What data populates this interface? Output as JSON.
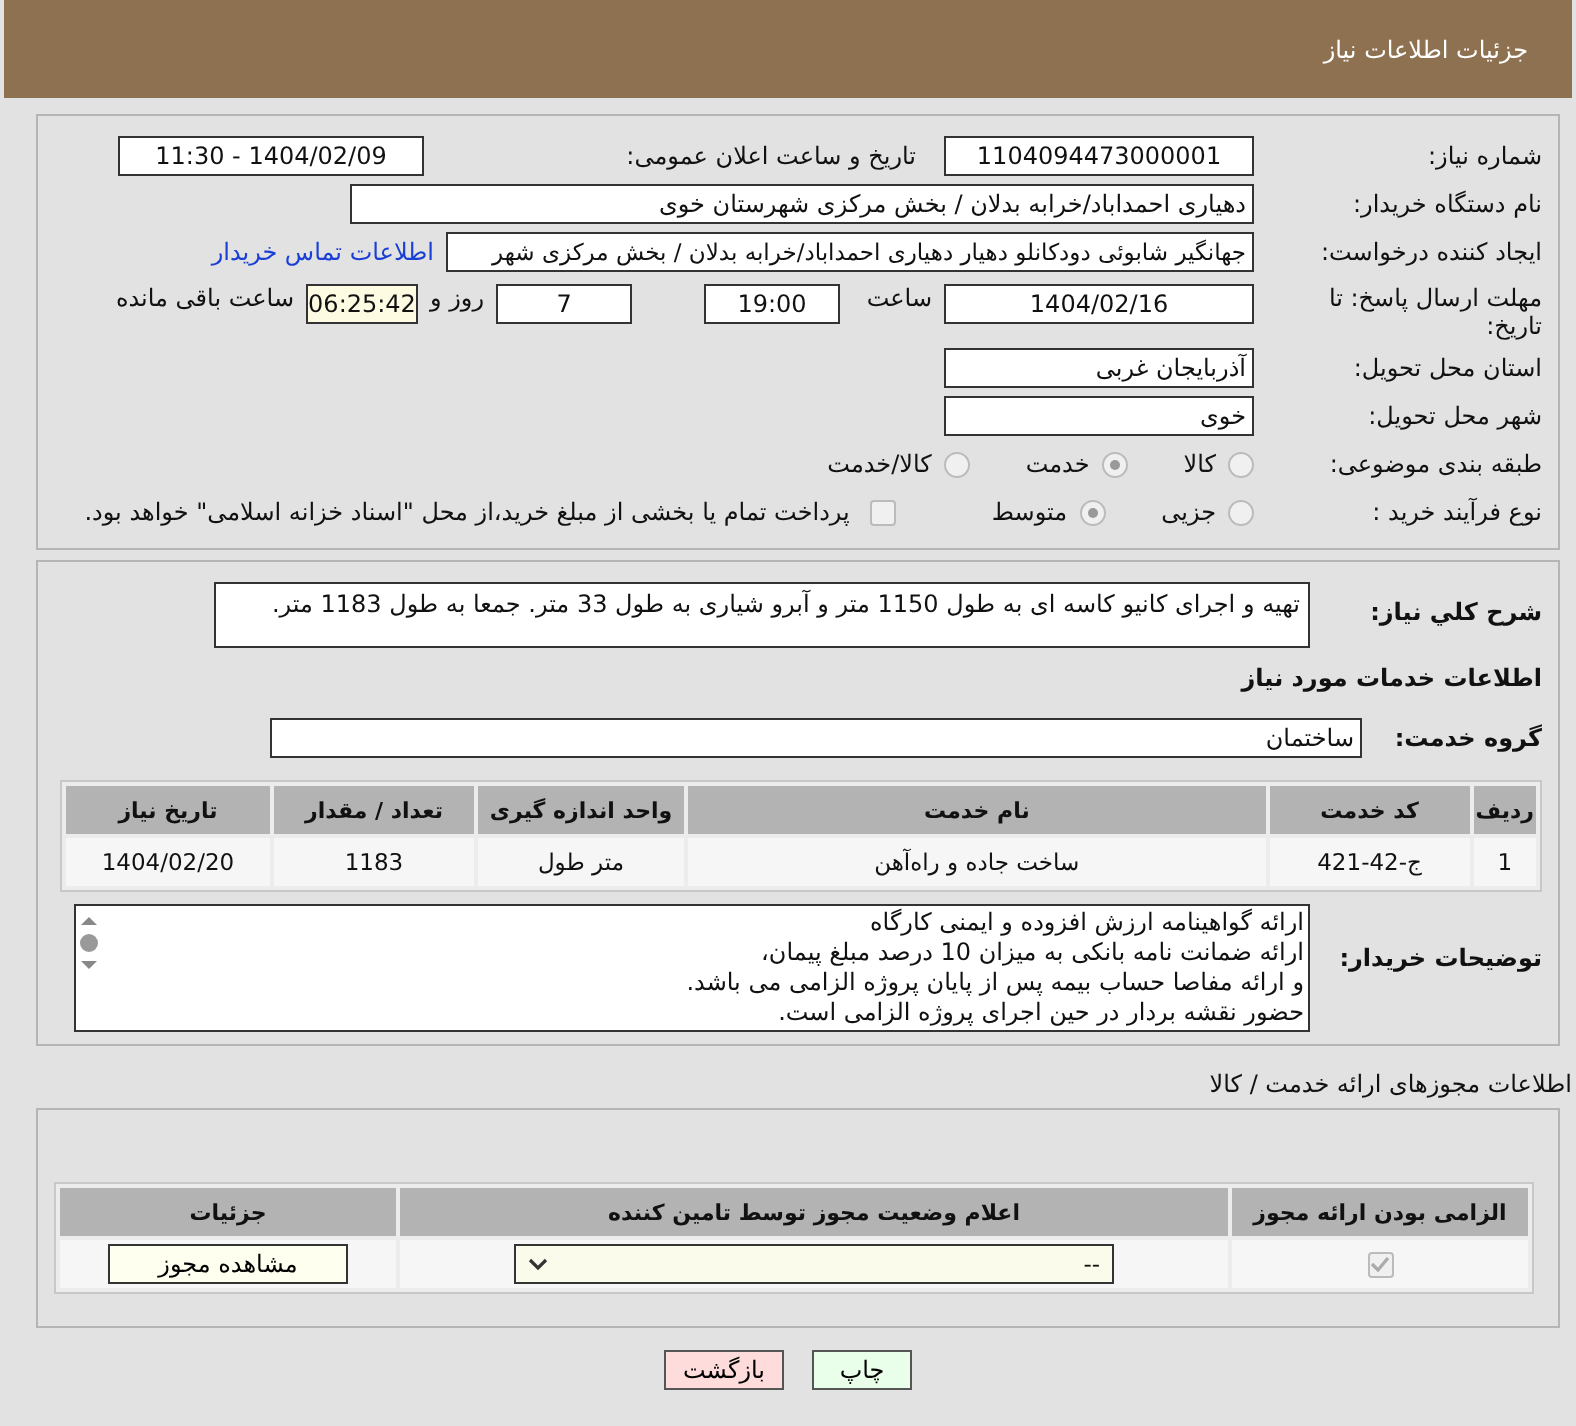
{
  "header": {
    "title": "جزئیات اطلاعات نیاز"
  },
  "need_info": {
    "need_number": {
      "label": "شماره نیاز:",
      "value": "1104094473000001"
    },
    "announce": {
      "label": "تاریخ و ساعت اعلان عمومی:",
      "value": "1404/02/09 - 11:30"
    },
    "buyer_org": {
      "label": "نام دستگاه خریدار:",
      "value": "دهیاری احمداباد/خرابه بدلان / بخش مرکزی شهرستان خوی"
    },
    "requester": {
      "label": "ایجاد کننده درخواست:",
      "value": "جهانگیر شابوئی دودکانلو دهیار دهیاری احمداباد/خرابه بدلان / بخش مرکزی شهر",
      "link": "اطلاعات تماس خریدار"
    },
    "deadline": {
      "label": "مهلت ارسال پاسخ: تا تاریخ:",
      "date": "1404/02/16",
      "time_label": "ساعت",
      "time": "19:00",
      "days": "7",
      "days_label": "روز و",
      "remaining": "06:25:42",
      "remaining_label": "ساعت باقی مانده"
    },
    "province": {
      "label": "استان محل تحویل:",
      "value": "آذربایجان غربی"
    },
    "city": {
      "label": "شهر محل تحویل:",
      "value": "خوی"
    },
    "category": {
      "label": "طبقه بندی موضوعی:",
      "options": [
        {
          "label": "کالا",
          "selected": false
        },
        {
          "label": "خدمت",
          "selected": true
        },
        {
          "label": "کالا/خدمت",
          "selected": false
        }
      ]
    },
    "process": {
      "label": "نوع فرآیند خرید :",
      "options": [
        {
          "label": "جزیی",
          "selected": false
        },
        {
          "label": "متوسط",
          "selected": true
        }
      ],
      "payment": {
        "label": "پرداخت تمام یا بخشی از مبلغ خرید،از محل \"اسناد خزانه اسلامی\" خواهد بود.",
        "checked": false
      }
    }
  },
  "details": {
    "description": {
      "label": "شرح کلي نياز:",
      "value": "تهیه و اجرای کانیو کاسه ای به طول 1150 متر و آبرو شیاری به طول 33 متر. جمعا به طول 1183 متر."
    },
    "services_heading": "اطلاعات خدمات مورد نیاز",
    "service_group": {
      "label": "گروه خدمت:",
      "value": "ساختمان"
    },
    "table": {
      "columns": [
        "ردیف",
        "کد خدمت",
        "نام خدمت",
        "واحد اندازه گیری",
        "تعداد / مقدار",
        "تاریخ نیاز"
      ],
      "rows": [
        [
          "1",
          "ج-42-421",
          "ساخت جاده و راه‌آهن",
          "متر طول",
          "1183",
          "1404/02/20"
        ]
      ]
    },
    "buyer_notes": {
      "label": "توضیحات خریدار:",
      "lines": [
        "ارائه گواهینامه ارزش افزوده و ایمنی کارگاه",
        "ارائه ضمانت نامه بانکی به میزان 10 درصد مبلغ پیمان،",
        "و ارائه مفاصا حساب بیمه پس از پایان پروژه الزامی می باشد.",
        "حضور نقشه بردار در حین اجرای پروژه الزامی است."
      ]
    }
  },
  "licenses": {
    "title": "اطلاعات مجوزهای ارائه خدمت / کالا",
    "columns": [
      "الزامی بودن ارائه مجوز",
      "اعلام وضعیت مجوز توسط تامین کننده",
      "جزئیات"
    ],
    "rows": [
      {
        "required": true,
        "status": "--",
        "action": "مشاهده مجوز"
      }
    ]
  },
  "buttons": [
    {
      "label": "چاپ",
      "kind": "print"
    },
    {
      "label": "بازگشت",
      "kind": "back"
    }
  ]
}
